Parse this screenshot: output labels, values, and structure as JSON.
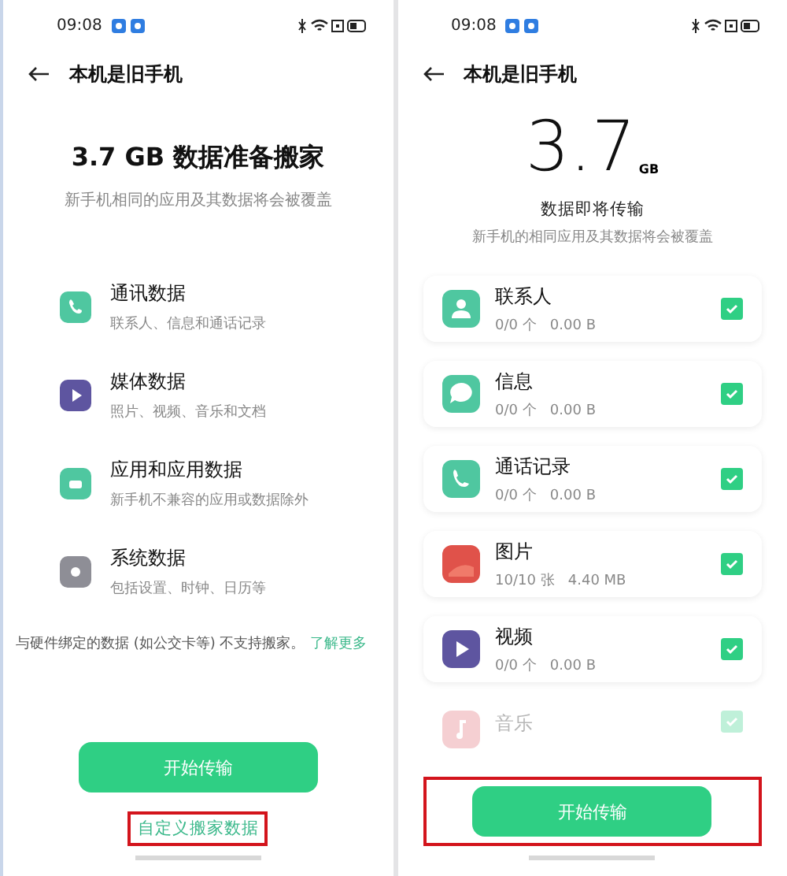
{
  "screens": [
    {
      "kind": "overview",
      "status_bar": {
        "time": "09:08"
      },
      "title": "本机是旧手机",
      "heading": "3.7 GB 数据准备搬家",
      "subtitle": "新手机相同的应用及其数据将会被覆盖",
      "categories": [
        {
          "kind": "phone",
          "color": "#4fc7a0",
          "name": "通讯数据",
          "desc": "联系人、信息和通话记录"
        },
        {
          "kind": "play",
          "color": "#5e55a0",
          "name": "媒体数据",
          "desc": "照片、视频、音乐和文档"
        },
        {
          "kind": "app",
          "color": "#4fc7a0",
          "name": "应用和应用数据",
          "desc": "新手机不兼容的应用或数据除外"
        },
        {
          "kind": "gear",
          "color": "#8e8e96",
          "name": "系统数据",
          "desc": "包括设置、时钟、日历等"
        }
      ],
      "notice": "与硬件绑定的数据 (如公交卡等) 不支持搬家。",
      "notice_link": "了解更多",
      "button": {
        "label": "开始传输"
      },
      "link": {
        "label": "自定义搬家数据",
        "highlighted": true
      }
    },
    {
      "kind": "list",
      "status_bar": {
        "time": "09:08"
      },
      "title": "本机是旧手机",
      "size": "3.7",
      "unit": "GB",
      "heading": "数据即将传输",
      "subtitle": "新手机的相同应用及其数据将会被覆盖",
      "items": [
        {
          "kind": "person",
          "color": "#4fc7a0",
          "name": "联系人",
          "count": "0/0 个",
          "amount": "0.00 B",
          "checked": true,
          "faded": false
        },
        {
          "kind": "bubble",
          "color": "#4fc7a0",
          "name": "信息",
          "count": "0/0 个",
          "amount": "0.00 B",
          "checked": true,
          "faded": false
        },
        {
          "kind": "phone",
          "color": "#4fc7a0",
          "name": "通话记录",
          "count": "0/0 个",
          "amount": "0.00 B",
          "checked": true,
          "faded": false
        },
        {
          "kind": "photo",
          "color": "#e0524a",
          "name": "图片",
          "count": "10/10 张",
          "amount": "4.40 MB",
          "checked": true,
          "faded": false
        },
        {
          "kind": "play",
          "color": "#5e55a0",
          "name": "视频",
          "count": "0/0 个",
          "amount": "0.00 B",
          "checked": true,
          "faded": false
        },
        {
          "kind": "note",
          "color": "#f5cfd2",
          "name": "音乐",
          "checked": true,
          "faded": true
        }
      ],
      "button": {
        "label": "开始传输",
        "highlighted": true
      }
    }
  ]
}
